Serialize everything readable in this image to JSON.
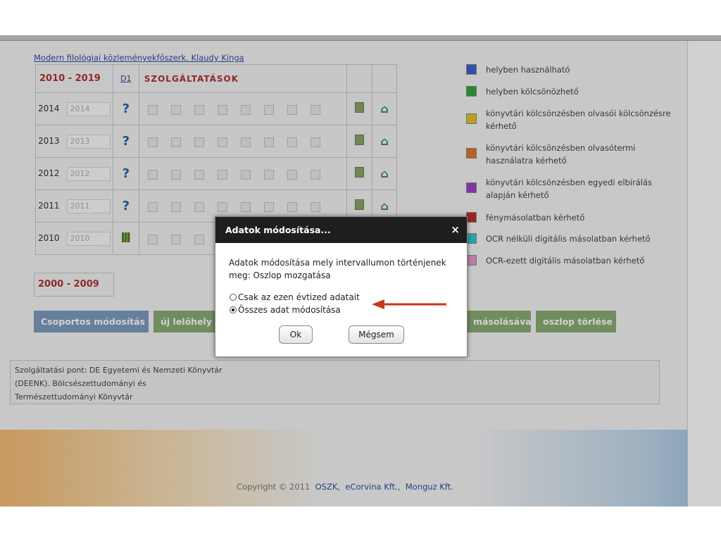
{
  "top_link": "Modern filológiai közleményekfőszerk. Klaudy Kinga",
  "grid": {
    "decade_label": "2010 - 2019",
    "d1_label": "D1",
    "services_label": "SZOLGÁLTATÁSOK",
    "rows": [
      {
        "year": "2014",
        "input_value": "2014",
        "icon": "question-icon",
        "icon_text": "?"
      },
      {
        "year": "2013",
        "input_value": "2013",
        "icon": "question-icon",
        "icon_text": "?"
      },
      {
        "year": "2012",
        "input_value": "2012",
        "icon": "question-icon",
        "icon_text": "?"
      },
      {
        "year": "2011",
        "input_value": "2011",
        "icon": "question-icon",
        "icon_text": "?"
      },
      {
        "year": "2010",
        "input_value": "2010",
        "icon": "books-icon",
        "icon_text": ""
      }
    ]
  },
  "decade2_label": "2000 - 2009",
  "buttons": {
    "group_edit": "Csoportos módosítás",
    "new_location": "új lelőhely h",
    "copy_partial": "másolásával",
    "delete_column": "oszlop törlése"
  },
  "legend": [
    {
      "color": "#3f63c8",
      "text": "helyben használható"
    },
    {
      "color": "#2fa53b",
      "text": "helyben kölcsönözhető"
    },
    {
      "color": "#e3c22a",
      "text": "könyvtári kölcsönzésben olvasói kölcsönzésre kérhető"
    },
    {
      "color": "#e0782c",
      "text": "könyvtári kölcsönzésben olvasótermi használatra kérhető"
    },
    {
      "color": "#a33fc9",
      "text": "könyvtári kölcsönzésben egyedi elbírálás alapján kérhető"
    },
    {
      "color": "#c42b2b",
      "text": "fénymásolatban kérhető"
    },
    {
      "color": "#2ec7cd",
      "text": "OCR nélküli digitális másolatban kérhető"
    },
    {
      "color": "#e69ac4",
      "text": "OCR-ezett digitális másolatban kérhető"
    }
  ],
  "footer": {
    "line1": "Szolgáltatási pont: DE Egyetemi és Nemzeti Könyvtár",
    "line2": "(DEENK). Bölcsészettudományi és",
    "line3": "Természettudományi Könyvtár"
  },
  "copyright": {
    "prefix": "Copyright © 2011",
    "link1": "OSZK,",
    "link2": "eCorvina Kft.,",
    "link3": "Monguz Kft."
  },
  "dialog": {
    "title": "Adatok módosítása...",
    "close": "×",
    "message": "Adatok módosítása mely intervallumon történjenek meg: Oszlop mozgatása",
    "option1": "Csak az ezen évtized adatait",
    "option2": "Összes adat módosítása",
    "selected_option": 2,
    "ok": "Ok",
    "cancel": "Mégsem"
  },
  "colors": {
    "arrow": "#c8361d",
    "decade_red": "#b23131",
    "button_blue": "#7d9bbf",
    "button_green": "#8aad74"
  }
}
